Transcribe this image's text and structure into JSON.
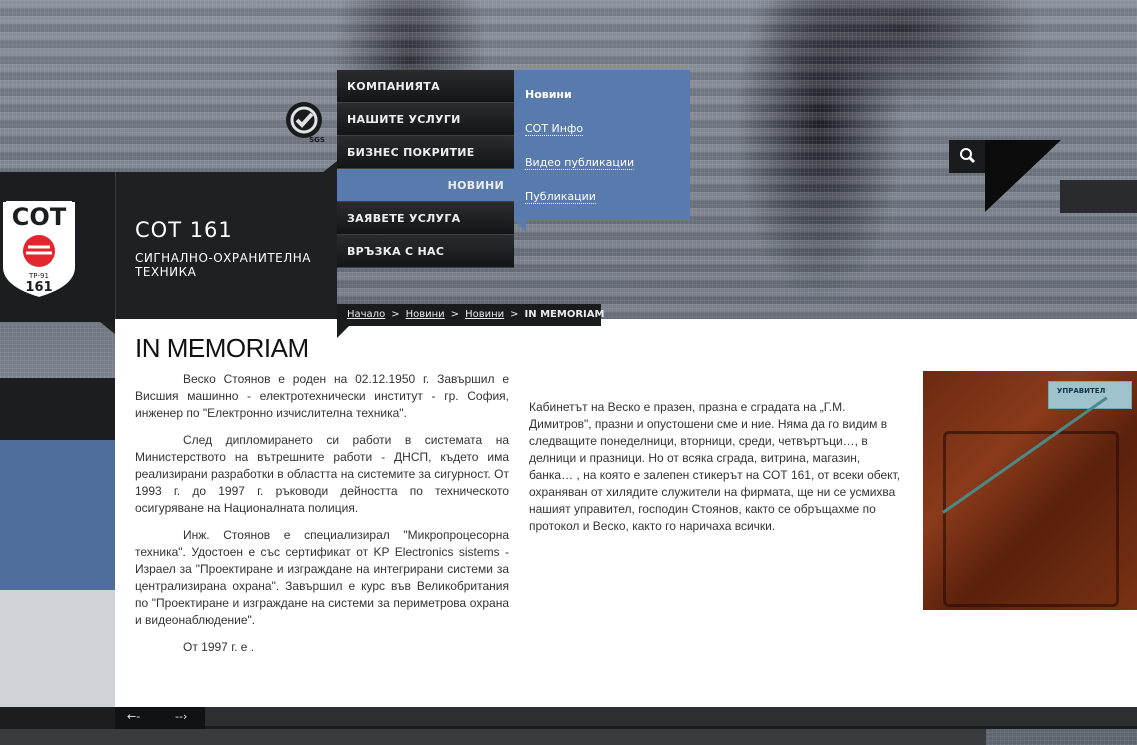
{
  "brand": {
    "logo_text": "СОТ",
    "logo_number": "161",
    "logo_small": "ТР-91",
    "title": "СОТ 161",
    "subtitle": "СИГНАЛНО-ОХРАНИТЕЛНА ТЕХНИКА"
  },
  "cert": {
    "label": "SGS"
  },
  "nav": {
    "items": [
      {
        "label": "КОМПАНИЯТА"
      },
      {
        "label": "НАШИТЕ УСЛУГИ"
      },
      {
        "label": "БИЗНЕС ПОКРИТИЕ"
      },
      {
        "label": "НОВИНИ"
      },
      {
        "label": "ЗАЯВЕТЕ УСЛУГА"
      },
      {
        "label": "ВРЪЗКА С НАС"
      }
    ],
    "active_index": 3
  },
  "submenu": {
    "items": [
      {
        "label": "Новини"
      },
      {
        "label": "СОТ Инфо"
      },
      {
        "label": "Видео публикации"
      },
      {
        "label": "Публикации"
      }
    ]
  },
  "search": {
    "icon": "search-icon"
  },
  "breadcrumb": {
    "items": [
      "Начало",
      "Новини",
      "Новини"
    ],
    "separator": ">",
    "current": "IN MEMORIAM"
  },
  "article": {
    "title": "IN MEMORIAM",
    "col1": [
      "Веско Стоянов е роден на 02.12.1950 г. Завършил е Висшия машинно - електротехнически институт - гр. София, инженер по \"Електронно изчислителна техника\".",
      "След дипломирането си работи в системата на Министерството на вътрешните работи - ДНСП, където има реализирани разработки в областта на системите за сигурност. От 1993 г. до 1997 г. ръководи дейността по техническото осигуряване на Националната полиция.",
      "Инж. Стоянов е специализирал \"Микропроцесорна техника\". Удостоен е със сертификат от KP Electronics sistems - Израел за \"Проектиране и изграждане на интегрирани системи за централизирана охрана\". Завършил е курс във Великобритания по \"Проектиране и изграждане на системи за периметрова охрана и видеонаблюдение\".",
      "От 1997 г. е ."
    ],
    "col2": "Кабинетът на Веско е празен, празна е сградата на „Г.М. Димитров\", празни и опустошени сме и ние. Няма да го видим в следващите понеделници, вторници, среди, четвъртъци…, в делници и празници.  Но от всяка сграда, витрина, магазин, банка… , на която е залепен стикерът на СОТ 161, от всеки обект, охраняван от хилядите служители на фирмата,  ще ни се усмихва нашият управител, господин Стоянов, както се обръщахме по протокол и Веско, както го наричаха всички.",
    "photo_plate": "УПРАВИТЕЛ"
  },
  "pager": {
    "prev": "←-",
    "next": "--›"
  },
  "colors": {
    "accent": "#587aac",
    "dark": "#1c1d1f"
  }
}
